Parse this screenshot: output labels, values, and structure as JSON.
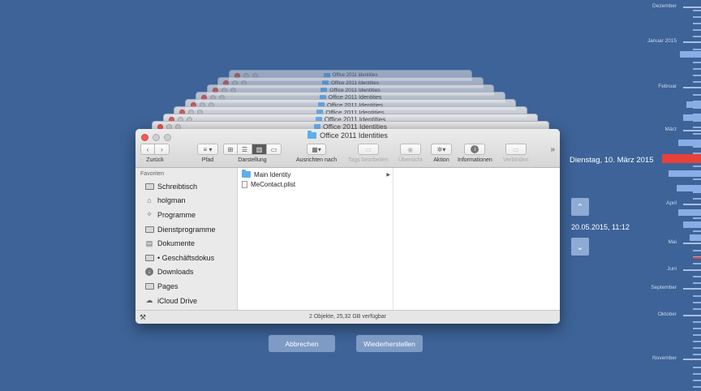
{
  "stack_windows": [
    {
      "title": "Office 2011 Identities"
    },
    {
      "title": "Office 2011 Identities"
    },
    {
      "title": "Office 2011 Identities"
    },
    {
      "title": "Office 2011 Identities"
    },
    {
      "title": "Office 2011 Identities"
    },
    {
      "title": "Office 2011 Identities"
    },
    {
      "title": "Office 2011 Identities"
    },
    {
      "title": "Office 2011 Identities"
    }
  ],
  "finder": {
    "title": "Office 2011 Identities",
    "toolbar": {
      "back_label": "Zurück",
      "path_label": "Pfad",
      "view_label": "Darstellung",
      "arrange_label": "Ausrichten nach",
      "tags_label": "Tags bearbeiten",
      "overview_label": "Übersicht",
      "action_label": "Aktion",
      "info_label": "Informationen",
      "connect_label": "Verbinden",
      "more": "»"
    },
    "sidebar": {
      "heading": "Favoriten",
      "items": [
        {
          "label": "Schreibtisch",
          "icon": "desktop-icon"
        },
        {
          "label": "holgman",
          "icon": "home-icon"
        },
        {
          "label": "Programme",
          "icon": "applications-icon"
        },
        {
          "label": "Dienstprogramme",
          "icon": "folder-icon"
        },
        {
          "label": "Dokumente",
          "icon": "documents-icon"
        },
        {
          "label": "• Geschäftsdokus",
          "icon": "folder-icon"
        },
        {
          "label": "Downloads",
          "icon": "download-icon"
        },
        {
          "label": "Pages",
          "icon": "folder-icon"
        },
        {
          "label": "iCloud Drive",
          "icon": "cloud-icon"
        }
      ]
    },
    "files": [
      {
        "name": "Main Identity",
        "type": "folder",
        "has_children": true
      },
      {
        "name": "MeContact.plist",
        "type": "file",
        "has_children": false
      }
    ],
    "status": "2 Objekte, 25,32 GB verfügbar"
  },
  "buttons": {
    "cancel": "Abbrechen",
    "restore": "Wiederherstellen"
  },
  "time_machine": {
    "current_date": "Dienstag, 10. März 2015",
    "snapshot_time": "20.05.2015, 11:12",
    "months": [
      "Dezember",
      "Januar 2015",
      "Februar",
      "März",
      "April",
      "Mai",
      "Juni",
      "September",
      "Oktober",
      "November"
    ],
    "accent_color": "#e8413a",
    "background_color": "#3d6398"
  }
}
